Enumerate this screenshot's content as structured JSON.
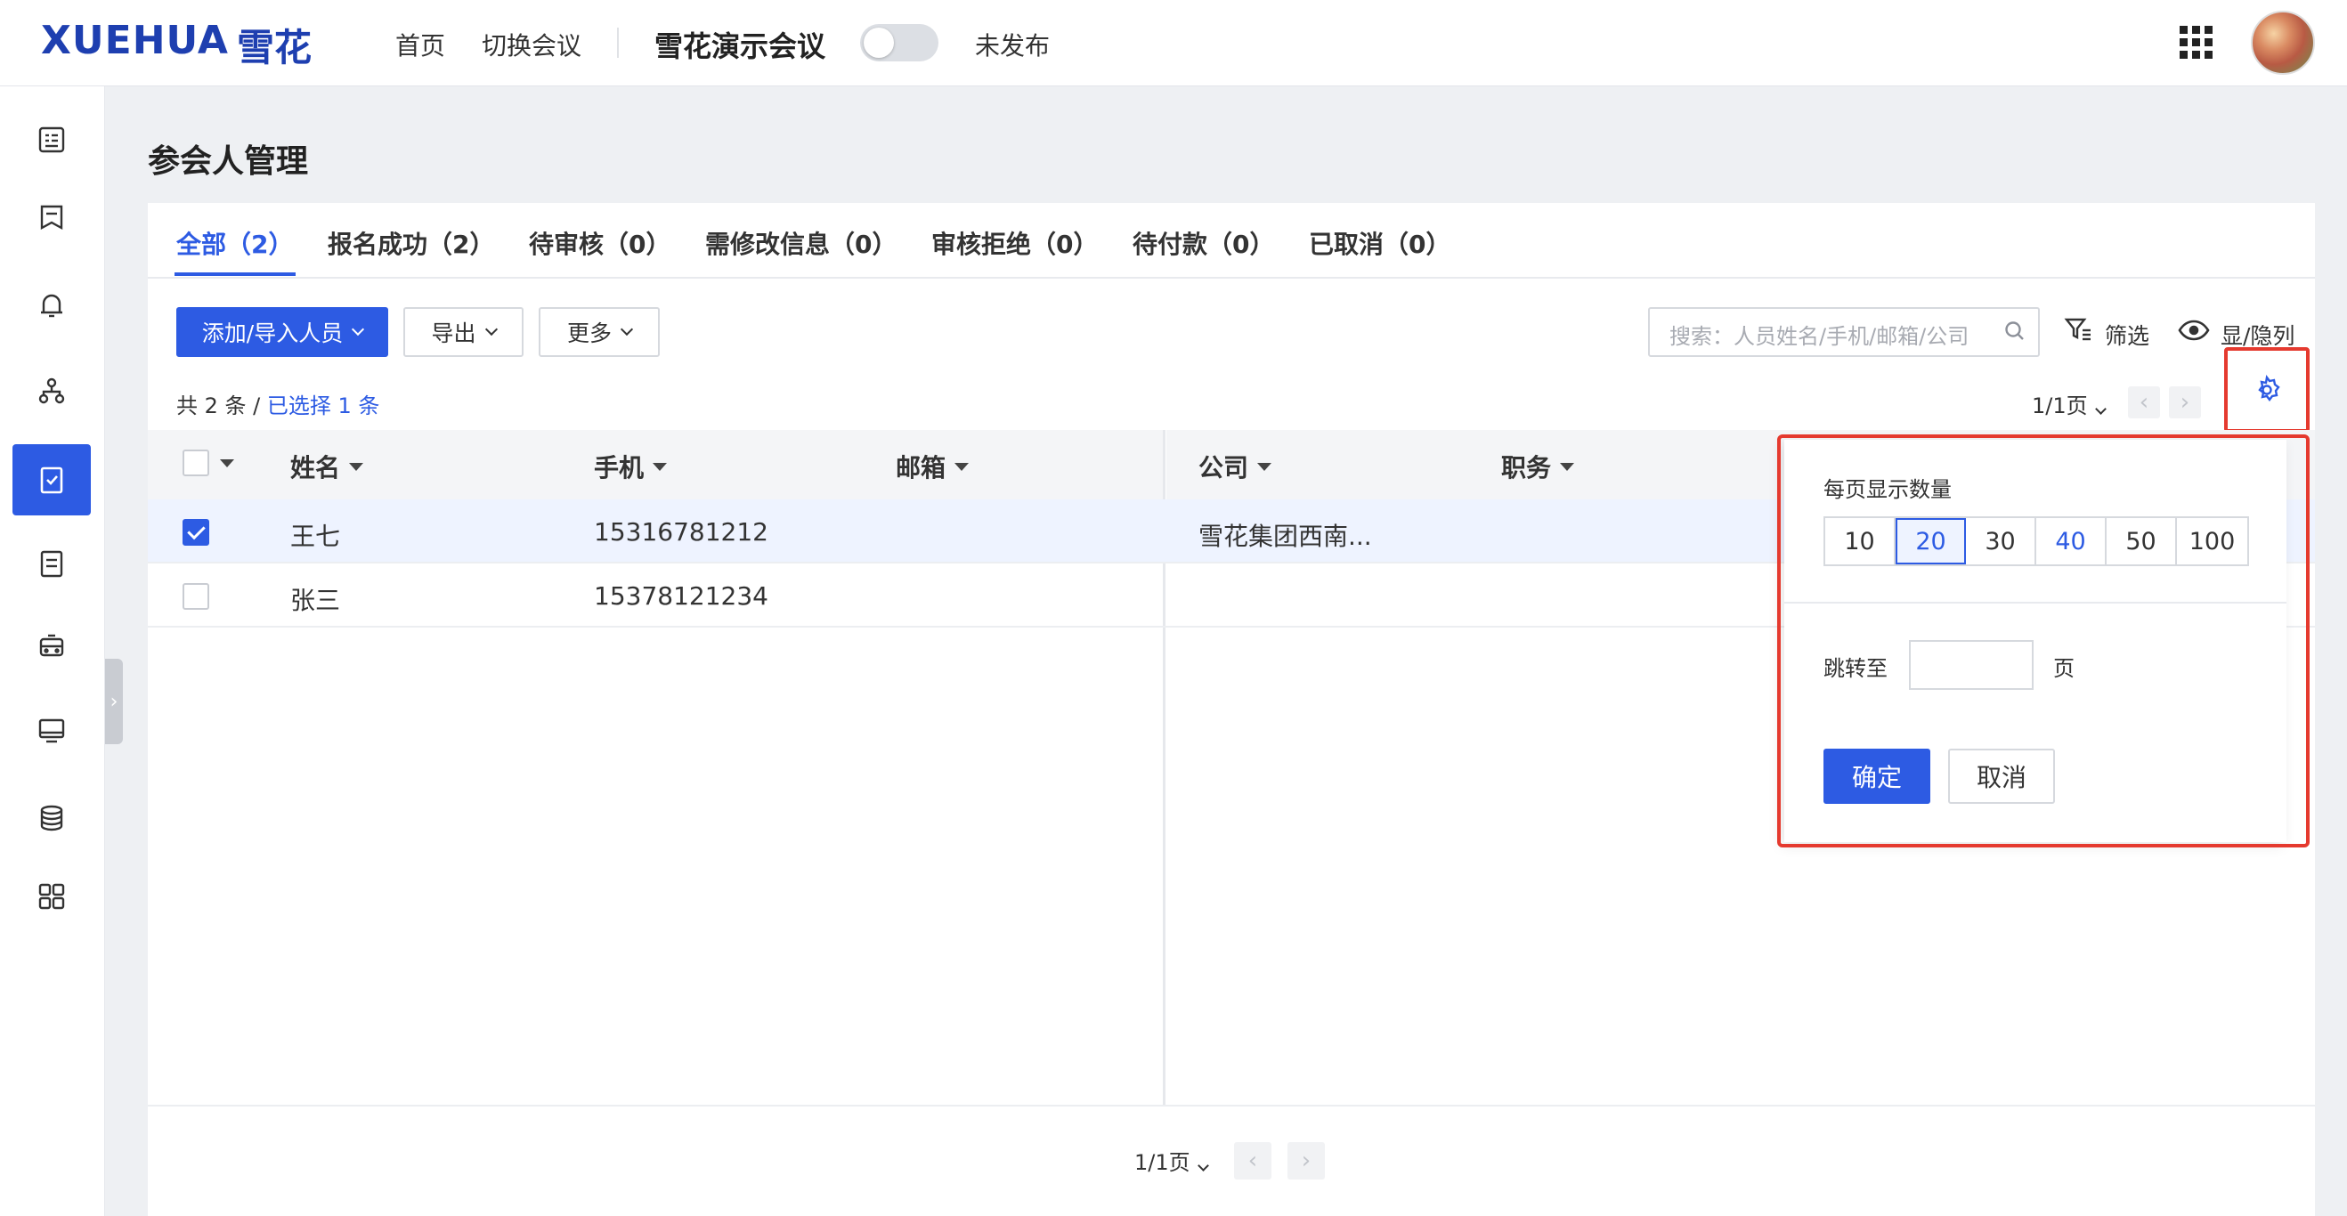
{
  "app": {
    "logo_en": "XUEHUA",
    "logo_cn": "雪花",
    "nav": [
      "首页",
      "切换会议"
    ],
    "conference_name": "雪花演示会议",
    "publish_status": "未发布"
  },
  "page": {
    "title": "参会人管理"
  },
  "tabs": [
    "全部（2）",
    "报名成功（2）",
    "待审核（0）",
    "需修改信息（0）",
    "审核拒绝（0）",
    "待付款（0）",
    "已取消（0）"
  ],
  "toolbar": {
    "add_label": "添加/导入人员",
    "export_label": "导出",
    "more_label": "更多",
    "search_placeholder": "搜索：人员姓名/手机/邮箱/公司",
    "filter_label": "筛选",
    "columns_label": "显/隐列"
  },
  "summary": {
    "total": "共 2 条 / ",
    "selected": "已选择 1 条"
  },
  "pager": {
    "label": "1/1页",
    "prev": "‹",
    "next": "›"
  },
  "table": {
    "columns": [
      "姓名",
      "手机",
      "邮箱",
      "公司",
      "职务"
    ],
    "rows": [
      {
        "name": "王七",
        "phone": "15316781212",
        "email": "",
        "company": "雪花集团西南...",
        "title": "",
        "checked": true
      },
      {
        "name": "张三",
        "phone": "15378121234",
        "email": "",
        "company": "",
        "title": "",
        "checked": false
      }
    ]
  },
  "popover": {
    "page_size_label": "每页显示数量",
    "sizes": [
      "10",
      "20",
      "30",
      "40",
      "50",
      "100"
    ],
    "selected_size": "20",
    "jump_label": "跳转至",
    "jump_unit": "页",
    "ok_label": "确定",
    "cancel_label": "取消"
  },
  "colors": {
    "accent": "#2d5be3",
    "highlight_frame": "#e53a2f"
  }
}
